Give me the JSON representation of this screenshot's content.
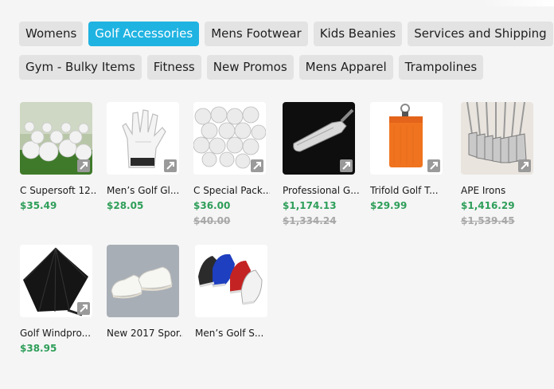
{
  "categories": {
    "row1": [
      {
        "label": "Womens",
        "active": false
      },
      {
        "label": "Golf Accessories",
        "active": true
      },
      {
        "label": "Mens Footwear",
        "active": false
      },
      {
        "label": "Kids Beanies",
        "active": false
      },
      {
        "label": "Services and Shipping",
        "active": false
      }
    ],
    "row2": [
      {
        "label": "Gym - Bulky Items",
        "active": false
      },
      {
        "label": "Fitness",
        "active": false
      },
      {
        "label": "New Promos",
        "active": false
      },
      {
        "label": "Mens Apparel",
        "active": false
      },
      {
        "label": "Trampolines",
        "active": false
      }
    ]
  },
  "colors": {
    "active_chip": "#1fb3e2",
    "price": "#2e9e59",
    "old_price": "#a8a8a8"
  },
  "products": [
    {
      "name": "C Supersoft 12...",
      "price": "$35.49",
      "old_price": null,
      "image": "golf-balls-grass"
    },
    {
      "name": "Men’s Golf Gl...",
      "price": "$28.05",
      "old_price": null,
      "image": "white-golf-glove"
    },
    {
      "name": "C Special Pack...",
      "price": "$36.00",
      "old_price": "$40.00",
      "image": "golf-balls-pile"
    },
    {
      "name": "Professional G...",
      "price": "$1,174.13",
      "old_price": "$1,334.24",
      "image": "golf-iron-head"
    },
    {
      "name": "Trifold Golf T...",
      "price": "$29.99",
      "old_price": null,
      "image": "orange-golf-towel"
    },
    {
      "name": "APE Irons",
      "price": "$1,416.29",
      "old_price": "$1,539.45",
      "image": "iron-set"
    },
    {
      "name": "Golf Windpro...",
      "price": "$38.95",
      "old_price": null,
      "image": "black-umbrella"
    },
    {
      "name": "New 2017 Spor...",
      "price": null,
      "old_price": null,
      "image": "white-sneakers"
    },
    {
      "name": "Men’s Golf S...",
      "price": null,
      "old_price": null,
      "image": "golf-shoes"
    }
  ]
}
